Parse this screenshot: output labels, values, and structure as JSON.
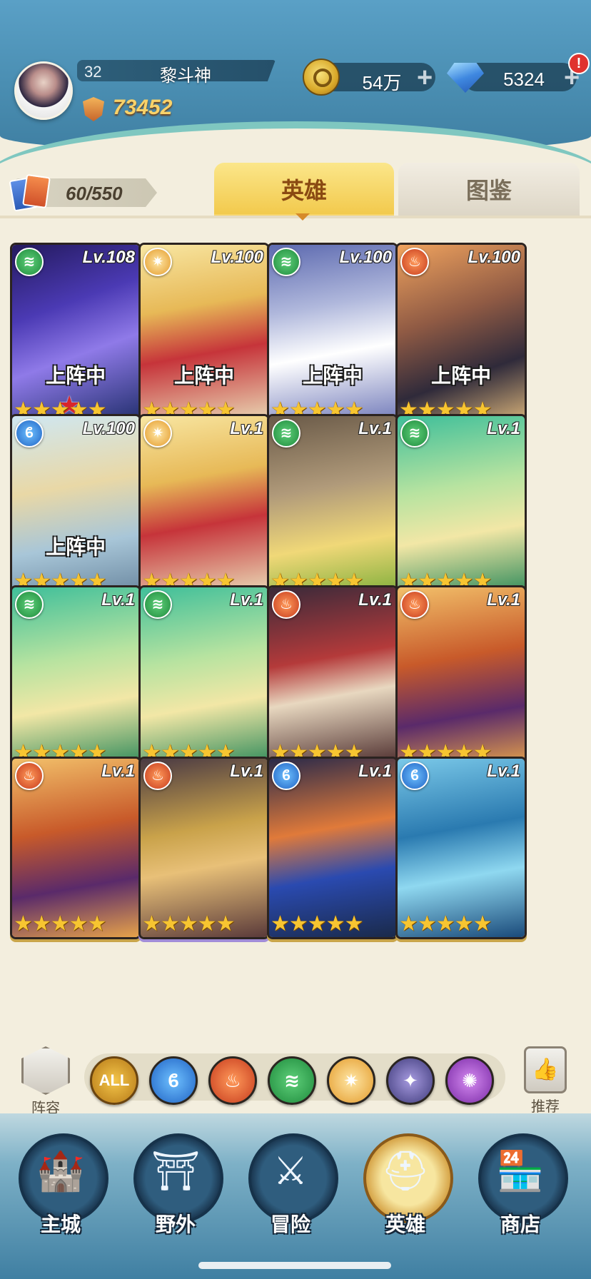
{
  "player": {
    "level": "32",
    "name": "黎斗神",
    "power": "73452"
  },
  "resources": {
    "gold": "54万",
    "gems": "5324",
    "plus_symbol": "+",
    "alert_symbol": "!"
  },
  "collection": {
    "count": "60/550"
  },
  "tabs": [
    {
      "label": "英雄",
      "active": true
    },
    {
      "label": "图鉴",
      "active": false
    }
  ],
  "heroes": [
    {
      "element": "wind",
      "level": "Lv.108",
      "deployed": "上阵中",
      "stars": "★★★★★",
      "extra_star": "★"
    },
    {
      "element": "light",
      "level": "Lv.100",
      "deployed": "上阵中",
      "stars": "★★★★★"
    },
    {
      "element": "wind",
      "level": "Lv.100",
      "deployed": "上阵中",
      "stars": "★★★★★"
    },
    {
      "element": "fire",
      "level": "Lv.100",
      "deployed": "上阵中",
      "stars": "★★★★★"
    },
    {
      "element": "water",
      "level": "Lv.100",
      "deployed": "上阵中",
      "stars": "★★★★★"
    },
    {
      "element": "light",
      "level": "Lv.1",
      "deployed": "",
      "stars": "★★★★★"
    },
    {
      "element": "wind",
      "level": "Lv.1",
      "deployed": "",
      "stars": "★★★★★"
    },
    {
      "element": "wind",
      "level": "Lv.1",
      "deployed": "",
      "stars": "★★★★★"
    },
    {
      "element": "wind",
      "level": "Lv.1",
      "deployed": "",
      "stars": "★★★★★"
    },
    {
      "element": "wind",
      "level": "Lv.1",
      "deployed": "",
      "stars": "★★★★★"
    },
    {
      "element": "fire",
      "level": "Lv.1",
      "deployed": "",
      "stars": "★★★★★"
    },
    {
      "element": "fire",
      "level": "Lv.1",
      "deployed": "",
      "stars": "★★★★★"
    },
    {
      "element": "fire",
      "level": "Lv.1",
      "deployed": "",
      "stars": "★★★★★"
    },
    {
      "element": "fire",
      "level": "Lv.1",
      "deployed": "",
      "stars": "★★★★★"
    },
    {
      "element": "water",
      "level": "Lv.1",
      "deployed": "",
      "stars": "★★★★★"
    },
    {
      "element": "water",
      "level": "Lv.1",
      "deployed": "",
      "stars": "★★★★★"
    }
  ],
  "filters": {
    "team_label": "阵容",
    "recommend_label": "推荐",
    "buttons": [
      {
        "key": "all",
        "label": "ALL"
      },
      {
        "key": "water",
        "label": ""
      },
      {
        "key": "fire",
        "label": ""
      },
      {
        "key": "wind",
        "label": ""
      },
      {
        "key": "light",
        "label": ""
      },
      {
        "key": "dark",
        "label": ""
      },
      {
        "key": "arcane",
        "label": ""
      }
    ]
  },
  "nav": [
    {
      "label": "主城",
      "icon": "castle-icon",
      "glyph": "🏰"
    },
    {
      "label": "野外",
      "icon": "portal-icon",
      "glyph": "⛩"
    },
    {
      "label": "冒险",
      "icon": "sword-icon",
      "glyph": "⚔"
    },
    {
      "label": "英雄",
      "icon": "helmet-icon",
      "glyph": "⛑",
      "active": true
    },
    {
      "label": "商店",
      "icon": "shop-icon",
      "glyph": "🏪"
    }
  ],
  "colors": {
    "header": "#4a8eb2",
    "background": "#f3eede",
    "active_tab": "#f2c94b",
    "star": "#f7c531",
    "alert": "#e0332e"
  }
}
